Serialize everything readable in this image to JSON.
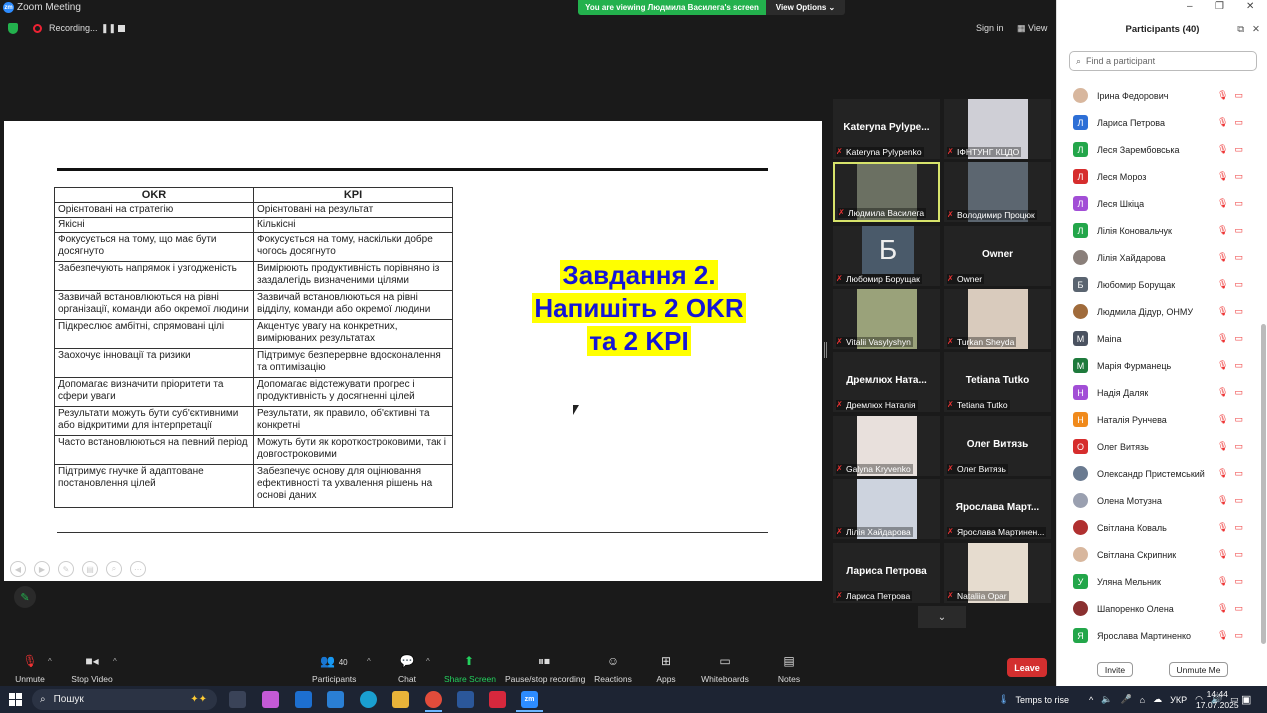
{
  "window": {
    "title": "Zoom Meeting",
    "controls": [
      "–",
      "❐",
      "✕"
    ]
  },
  "banner": {
    "viewing": "You are viewing Людмила Василега's screen",
    "options": "View Options"
  },
  "meetbar": {
    "recording": "Recording...",
    "pause": "❚❚",
    "sign_in": "Sign in",
    "view": "View"
  },
  "slide": {
    "table_headers": [
      "OKR",
      "KPI"
    ],
    "rows": [
      [
        "Орієнтовані на стратегію",
        "Орієнтовані на результат"
      ],
      [
        "Якісні",
        "Кількісні"
      ],
      [
        "Фокусується на тому, що має бути досягнуто",
        "Фокусується на тому, наскільки добре чогось досягнуто"
      ],
      [
        "Забезпечують напрямок і узгодженість",
        "Вимірюють продуктивність порівняно із заздалегідь визначеними цілями"
      ],
      [
        "Зазвичай встановлюються на рівні організації, команди або окремої людини",
        "Зазвичай встановлюються на рівні відділу, команди або окремої людини"
      ],
      [
        "Підкреслює амбітні, спрямовані цілі",
        "Акцентує увагу на конкретних, вимірюваних результатах"
      ],
      [
        "Заохочує інновації та ризики",
        "Підтримує безперервне вдосконалення та оптимізацію"
      ],
      [
        "Допомагає визначити пріоритети та сфери уваги",
        "Допомагає відстежувати прогрес і продуктивність у досягненні цілей"
      ],
      [
        "Результати можуть бути суб'єктивними або відкритими для інтерпретації",
        "Результати, як правило, об'єктивні та конкретні"
      ],
      [
        "Часто встановлюються на певний період",
        "Можуть бути як короткостроковими, так і довгостроковими"
      ],
      [
        "Підтримує гнучке й адаптоване постановлення цілей",
        "Забезпечує основу для оцінювання ефективності та ухвалення рішень на основі даних"
      ]
    ],
    "task_lines": [
      "Завдання 2.",
      "Напишіть 2 OKR",
      "та 2 KPI"
    ]
  },
  "gallery": [
    {
      "name_center": "Kateryna  Pylype...",
      "label": "Kateryna Pylypenko",
      "type": "name"
    },
    {
      "name_center": "",
      "label": "ІФНТУНГ КЦДО",
      "type": "video",
      "color": "#cfcfd6"
    },
    {
      "name_center": "",
      "label": "Людмила Василега",
      "type": "video",
      "color": "#6b7062",
      "active": true
    },
    {
      "name_center": "",
      "label": "Володимир Процюк",
      "type": "video",
      "color": "#5c6670"
    },
    {
      "name_center": "",
      "label": "Любомир Борущак",
      "type": "letter",
      "letter": "Б"
    },
    {
      "name_center": "Owner",
      "label": "Owner",
      "type": "name"
    },
    {
      "name_center": "",
      "label": "Vitalii Vasylyshyn",
      "type": "video",
      "color": "#9aa27a"
    },
    {
      "name_center": "",
      "label": "Turkan Sheyda",
      "type": "video",
      "color": "#d9cbbd"
    },
    {
      "name_center": "Дремлюх  Ната...",
      "label": "Дремлюх Наталія",
      "type": "name"
    },
    {
      "name_center": "Tetiana Tutko",
      "label": "Tetiana Tutko",
      "type": "name"
    },
    {
      "name_center": "",
      "label": "Galyna Kryvenko",
      "type": "video",
      "color": "#e8e0dc"
    },
    {
      "name_center": "Олег Витязь",
      "label": "Олег Витязь",
      "type": "name"
    },
    {
      "name_center": "",
      "label": "Лілія Хайдарова",
      "type": "video",
      "color": "#cdd3de"
    },
    {
      "name_center": "Ярослава  Март...",
      "label": "Ярослава Мартинен...",
      "type": "name"
    },
    {
      "name_center": "Лариса Петрова",
      "label": "Лариса Петрова",
      "type": "name"
    },
    {
      "name_center": "",
      "label": "Nataliia Opar",
      "type": "video",
      "color": "#e6dccf"
    }
  ],
  "toolbar": {
    "unmute": "Unmute",
    "stop_video": "Stop Video",
    "participants": "Participants",
    "participants_count": "40",
    "chat": "Chat",
    "share_screen": "Share Screen",
    "pause_stop": "Pause/stop recording",
    "reactions": "Reactions",
    "apps": "Apps",
    "whiteboards": "Whiteboards",
    "notes": "Notes",
    "leave": "Leave"
  },
  "panel": {
    "title": "Participants (40)",
    "search_placeholder": "Find a participant",
    "invite": "Invite",
    "unmute_me": "Unmute Me",
    "participants": [
      {
        "name": "Ірина Федорович",
        "letter": "",
        "color": "#d8b79e",
        "photo": true
      },
      {
        "name": "Лариса Петрова",
        "letter": "Л",
        "color": "#2d6fd6"
      },
      {
        "name": "Леся Зарембовська",
        "letter": "Л",
        "color": "#23a64a"
      },
      {
        "name": "Леся Мороз",
        "letter": "Л",
        "color": "#d62d2d"
      },
      {
        "name": "Леся Шкіца",
        "letter": "Л",
        "color": "#a24ed6"
      },
      {
        "name": "Лілія Коновальчук",
        "letter": "Л",
        "color": "#23a64a"
      },
      {
        "name": "Лілія Хайдарова",
        "letter": "",
        "color": "#8a7f7a",
        "photo": true
      },
      {
        "name": "Любомир Борущак",
        "letter": "Б",
        "color": "#5a6470"
      },
      {
        "name": "Людмила Дідур, ОНМУ",
        "letter": "",
        "color": "#a06b3b",
        "photo": true
      },
      {
        "name": "Maina",
        "letter": "M",
        "color": "#4a5260"
      },
      {
        "name": "Марія Фурманець",
        "letter": "M",
        "color": "#1e7a3c"
      },
      {
        "name": "Надія Даляк",
        "letter": "Н",
        "color": "#a24ed6"
      },
      {
        "name": "Наталія Рунчева",
        "letter": "Н",
        "color": "#f08a1c"
      },
      {
        "name": "Олег Витязь",
        "letter": "О",
        "color": "#d62d2d"
      },
      {
        "name": "Олександр Пристемський",
        "letter": "",
        "color": "#6a7a90",
        "photo": true
      },
      {
        "name": "Олена Мотузна",
        "letter": "",
        "color": "#9aa0b0",
        "photo": true
      },
      {
        "name": "Світлана Коваль",
        "letter": "",
        "color": "#b03030",
        "photo": true
      },
      {
        "name": "Світлана Скрипник",
        "letter": "",
        "color": "#d8b79e",
        "photo": true
      },
      {
        "name": "Уляна Мельник",
        "letter": "У",
        "color": "#23a64a"
      },
      {
        "name": "Шапоренко Олена",
        "letter": "",
        "color": "#8a3030",
        "photo": true
      },
      {
        "name": "Ярослава Мартиненко",
        "letter": "Я",
        "color": "#23a64a"
      }
    ]
  },
  "taskbar": {
    "search": "Пошук",
    "weather": "Temps to rise",
    "lang": "УКР",
    "time": "14:44",
    "date": "17.07.2025"
  }
}
